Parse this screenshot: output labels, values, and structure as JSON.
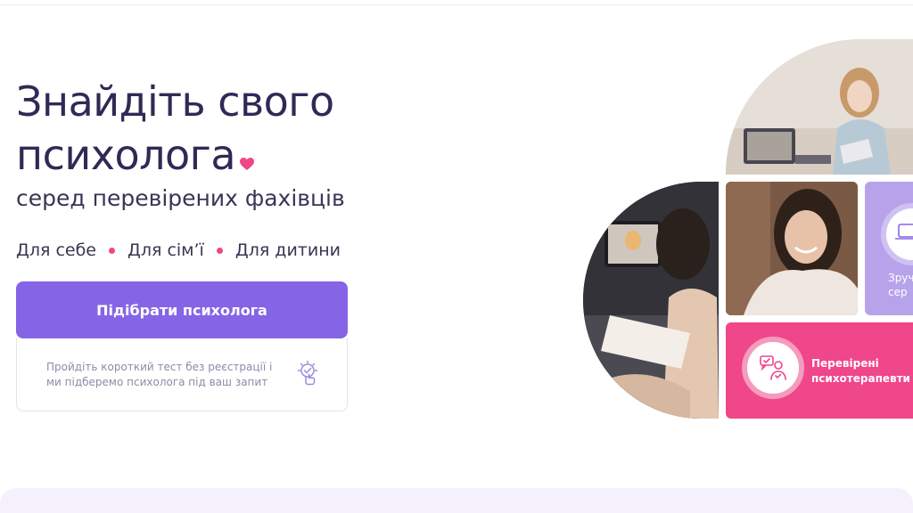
{
  "hero": {
    "title_line1": "Знайдіть свого",
    "title_line2": "психолога",
    "subtitle": "серед перевірених фахівців"
  },
  "audience": {
    "items": [
      "Для себе",
      "Для сім’ї",
      "Для дитини"
    ],
    "dot_color": "#f0468a"
  },
  "cta": {
    "label": "Підібрати психолога",
    "color": "#8565e6"
  },
  "test_card": {
    "text": "Пройдіть короткий тест без реєстрації і ми підберемо психолога під ваш запит",
    "icon": "lightbulb-check-icon"
  },
  "collage": {
    "photos": [
      "woman-laptop-photo",
      "video-session-photo",
      "smiling-woman-photo"
    ],
    "card_lilac": {
      "label_line1": "Зруч",
      "label_line2": "сер",
      "icon": "chat-laptop-icon",
      "color": "#b7a3ea"
    },
    "card_pink": {
      "label_line1": "Перевірені",
      "label_line2": "психотерапевти",
      "icon": "verified-psychologist-icon",
      "color": "#f0468a"
    }
  },
  "colors": {
    "heading": "#2f2a55",
    "accent_purple": "#8565e6",
    "accent_pink": "#f0468a"
  }
}
